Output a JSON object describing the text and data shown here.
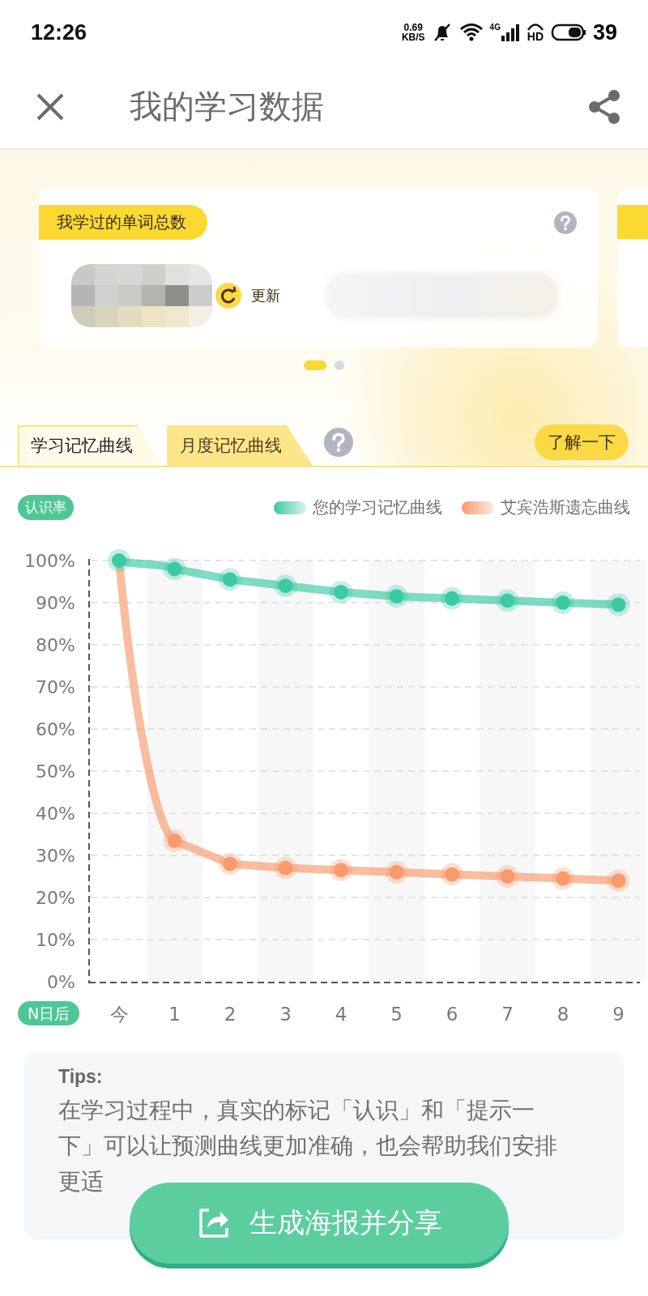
{
  "status_bar": {
    "time": "12:26",
    "net_speed": "0.69",
    "net_unit": "KB/S",
    "network": "4G",
    "hd": "HD",
    "battery": "39"
  },
  "header": {
    "title": "我的学习数据"
  },
  "summary_card": {
    "label": "我学过的单词总数",
    "refresh": "更新"
  },
  "carousel": [
    {
      "selected": true
    },
    {
      "selected": false
    }
  ],
  "tabs": [
    {
      "label": "学习记忆曲线",
      "selected": true
    },
    {
      "label": "月度记忆曲线",
      "selected": false
    }
  ],
  "learn_more": "了解一下",
  "chart": {
    "y_badge": "认识率",
    "x_badge": "N日后",
    "chart_data": {
      "type": "line",
      "grid": true,
      "categories": [
        "今",
        "1",
        "2",
        "3",
        "4",
        "5",
        "6",
        "7",
        "8",
        "9"
      ],
      "ylim": [
        0,
        100
      ],
      "yticks": [
        {
          "value": 0,
          "label": "0%"
        },
        {
          "value": 10,
          "label": "10%"
        },
        {
          "value": 20,
          "label": "20%"
        },
        {
          "value": 30,
          "label": "30%"
        },
        {
          "value": 40,
          "label": "40%"
        },
        {
          "value": 50,
          "label": "50%"
        },
        {
          "value": 60,
          "label": "60%"
        },
        {
          "value": 70,
          "label": "70%"
        },
        {
          "value": 80,
          "label": "80%"
        },
        {
          "value": 90,
          "label": "90%"
        },
        {
          "value": 100,
          "label": "100%"
        }
      ],
      "series": [
        {
          "name": "您的学习记忆曲线",
          "color": "#3cc9a4",
          "marker": "circle",
          "values": [
            100,
            98,
            95.5,
            94,
            92.5,
            91.5,
            91,
            90.5,
            90,
            89.5
          ]
        },
        {
          "name": "艾宾浩斯遗忘曲线",
          "color": "#f99a6c",
          "marker": "circle",
          "values": [
            100,
            33.5,
            28,
            27,
            26.5,
            26,
            25.5,
            25,
            24.5,
            24
          ]
        }
      ]
    }
  },
  "tips": {
    "title": "Tips:",
    "text": "在学习过程中，真实的标记「认识」和「提示一下」可以让预测曲线更加准确，也会帮助我们安排更适"
  },
  "share_button": "生成海报并分享"
}
